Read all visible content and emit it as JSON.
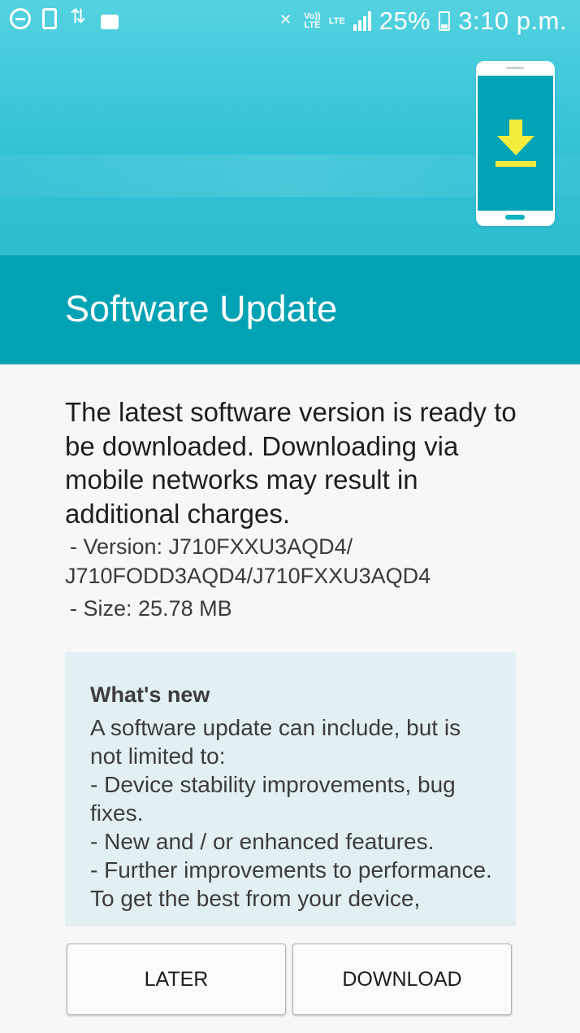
{
  "status_bar": {
    "battery": "25%",
    "time": "3:10 p.m.",
    "network_top": "Vo))",
    "network_bottom": "LTE",
    "network_type": "LTE",
    "icons": [
      "dnd-icon",
      "phone-icon",
      "sync-icon",
      "briefcase-icon",
      "vibrate-mute-icon",
      "volte-icon",
      "lte-icon",
      "signal-icon",
      "battery-icon"
    ]
  },
  "header": {
    "title": "Software Update",
    "illustration": "phone-download-icon"
  },
  "content": {
    "intro": "The latest software version is ready to be downloaded. Downloading via mobile networks may result in additional charges.",
    "version_label": "- Version: J710FXXU3AQD4/",
    "version_cont": "J710FODD3AQD4/J710FXXU3AQD4",
    "size": "- Size: 25.78 MB"
  },
  "whats_new": {
    "title": "What's new",
    "line1": "A software update can include, but is not limited to:",
    "line2": " - Device stability improvements, bug fixes.",
    "line3": " - New and / or enhanced features.",
    "line4": " - Further improvements to performance.",
    "line5": "To get the best from your device,"
  },
  "actions": {
    "later_label": "LATER",
    "download_label": "DOWNLOAD"
  },
  "colors": {
    "hero_top": "#55d2e0",
    "title_bar": "#00a2b3",
    "panel": "#e2f0f3",
    "download_arrow": "#f2ed3d"
  }
}
